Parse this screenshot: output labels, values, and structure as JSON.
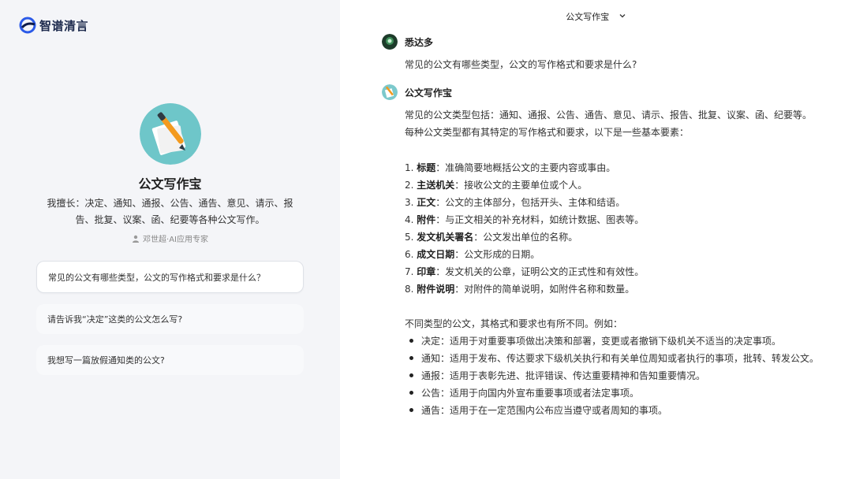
{
  "brand": {
    "name": "智谱清言",
    "color": "#2b5ae8"
  },
  "agent": {
    "name": "公文写作宝",
    "desc_line1": "我擅长：决定、通知、通报、公告、通告、意见、请示、报",
    "desc_line2": "告、批复、议案、函、纪要等各种公文写作。",
    "author": "邓世超·AI应用专家"
  },
  "suggestions": [
    "常见的公文有哪些类型，公文的写作格式和要求是什么？",
    "请告诉我“决定”这类的公文怎么写?",
    "我想写一篇放假通知类的公文?"
  ],
  "topbar": {
    "title": "公文写作宝"
  },
  "chat": {
    "user": {
      "name": "悉达多",
      "text": "常见的公文有哪些类型，公文的写作格式和要求是什么?"
    },
    "bot": {
      "name": "公文写作宝",
      "intro1": "常见的公文类型包括：通知、通报、公告、通告、意见、请示、报告、批复、议案、函、纪要等。",
      "intro2": "每种公文类型都有其特定的写作格式和要求，以下是一些基本要素：",
      "elements": [
        {
          "num": "1.",
          "term": "标题",
          "desc": "：准确简要地概括公文的主要内容或事由。"
        },
        {
          "num": "2.",
          "term": "主送机关",
          "desc": "：接收公文的主要单位或个人。"
        },
        {
          "num": "3.",
          "term": "正文",
          "desc": "：公文的主体部分，包括开头、主体和结语。"
        },
        {
          "num": "4.",
          "term": "附件",
          "desc": "：与正文相关的补充材料，如统计数据、图表等。"
        },
        {
          "num": "5.",
          "term": "发文机关署名",
          "desc": "：公文发出单位的名称。"
        },
        {
          "num": "6.",
          "term": "成文日期",
          "desc": "：公文形成的日期。"
        },
        {
          "num": "7.",
          "term": "印章",
          "desc": "：发文机关的公章，证明公文的正式性和有效性。"
        },
        {
          "num": "8.",
          "term": "附件说明",
          "desc": "：对附件的简单说明，如附件名称和数量。"
        }
      ],
      "diff_intro": "不同类型的公文，其格式和要求也有所不同。例如：",
      "types": [
        "决定：适用于对重要事项做出决策和部署，变更或者撤销下级机关不适当的决定事项。",
        "通知：适用于发布、传达要求下级机关执行和有关单位周知或者执行的事项，批转、转发公文。",
        "通报：适用于表彰先进、批评错误、传达重要精神和告知重要情况。",
        "公告：适用于向国内外宣布重要事项或者法定事项。",
        "通告：适用于在一定范围内公布应当遵守或者周知的事项。"
      ]
    }
  }
}
